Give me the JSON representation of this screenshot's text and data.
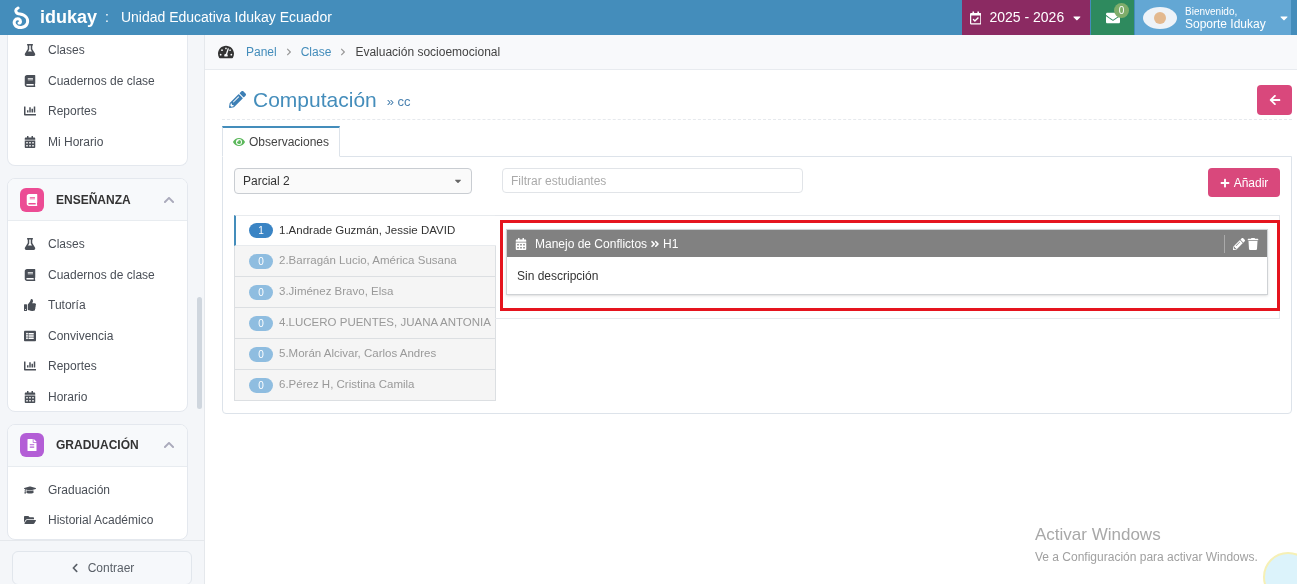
{
  "header": {
    "brand": "idukay",
    "separator": ":",
    "school": "Unidad Educativa Idukay Ecuador",
    "year": "2025 - 2026",
    "messages_count": "0",
    "welcome": "Bienvenido,",
    "user": "Soporte Idukay"
  },
  "sidebar": {
    "top_items": [
      {
        "kind": "flask",
        "label": "Clases"
      },
      {
        "kind": "book",
        "label": "Cuadernos de clase"
      },
      {
        "kind": "chart",
        "label": "Reportes"
      },
      {
        "kind": "calendar",
        "label": "Mi Horario"
      }
    ],
    "sections": [
      {
        "title": "ENSEÑANZA",
        "kind": "book",
        "color": "#ec4c94",
        "expanded": true,
        "items": [
          {
            "kind": "flask",
            "label": "Clases"
          },
          {
            "kind": "book",
            "label": "Cuadernos de clase"
          },
          {
            "kind": "thumb",
            "label": "Tutoría"
          },
          {
            "kind": "list",
            "label": "Convivencia"
          },
          {
            "kind": "chart",
            "label": "Reportes"
          },
          {
            "kind": "calendar",
            "label": "Horario"
          }
        ]
      },
      {
        "title": "GRADUACIÓN",
        "kind": "file",
        "color": "#b35ed6",
        "expanded": true,
        "items": [
          {
            "kind": "cap",
            "label": "Graduación"
          },
          {
            "kind": "folder",
            "label": "Historial Académico"
          }
        ]
      }
    ],
    "collapse": "Contraer"
  },
  "breadcrumb": [
    {
      "label": "Panel",
      "kind": "link"
    },
    {
      "label": "Clase",
      "kind": "link"
    },
    {
      "label": "Evaluación socioemocional",
      "kind": "current"
    }
  ],
  "page": {
    "title": "Computación",
    "subtitle": "» cc"
  },
  "tabs": [
    {
      "label": "Observaciones",
      "selected": true
    }
  ],
  "period_select": {
    "value": "Parcial 2"
  },
  "filter": {
    "placeholder": "Filtrar estudiantes"
  },
  "add_button": "Añadir",
  "students": [
    {
      "count": "1",
      "name": "1.Andrade Guzmán, Jessie DAVID",
      "selected": true
    },
    {
      "count": "0",
      "name": "2.Barragán Lucio, América Susana",
      "selected": false
    },
    {
      "count": "0",
      "name": "3.Jiménez Bravo, Elsa",
      "selected": false
    },
    {
      "count": "0",
      "name": "4.LUCERO PUENTES, JUANA ANTONIA",
      "selected": false
    },
    {
      "count": "0",
      "name": "5.Morán Alcivar, Carlos Andres",
      "selected": false
    },
    {
      "count": "0",
      "name": "6.Pérez H, Cristina Camila",
      "selected": false
    }
  ],
  "observation": {
    "title": "Manejo de Conflictos",
    "sub": "H1",
    "body": "Sin descripción",
    "highlighted": true
  },
  "activation": {
    "title": "Activar Windows",
    "body": "Ve a Configuración para activar Windows."
  }
}
